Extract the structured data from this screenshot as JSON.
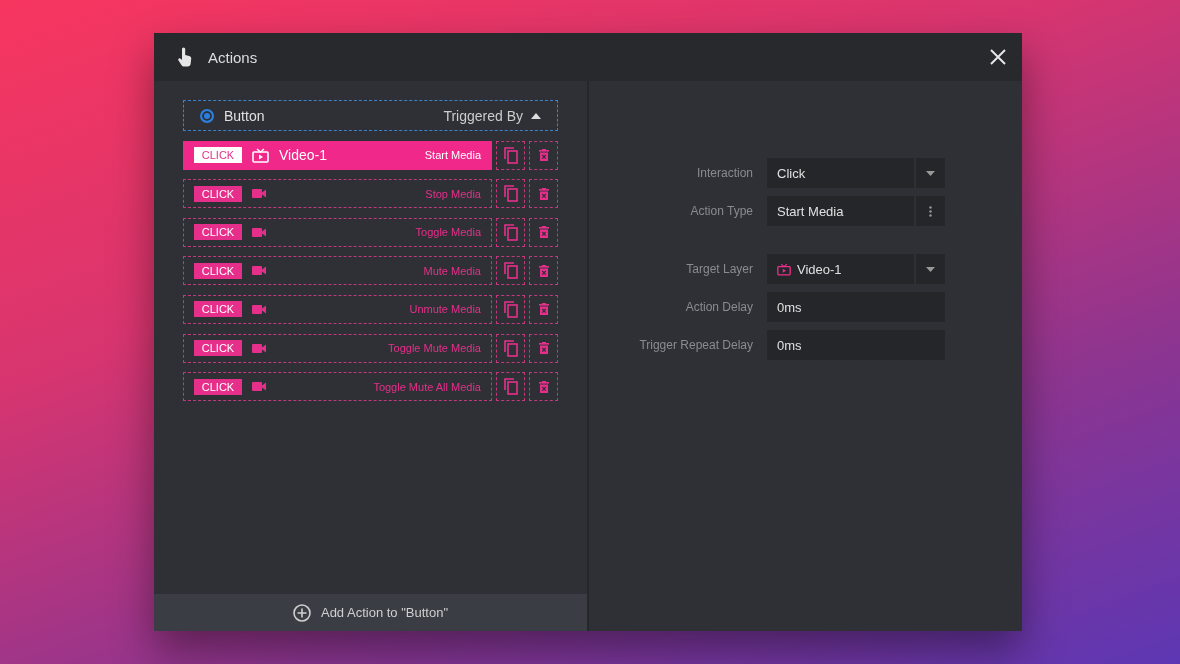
{
  "window": {
    "title": "Actions"
  },
  "trigger_header": {
    "label": "Button",
    "selected": true,
    "toggle_label": "Triggered By",
    "expanded": true
  },
  "actions": [
    {
      "trigger": "CLICK",
      "kind": "video",
      "target": "Video-1",
      "action": "Start Media",
      "selected": true
    },
    {
      "trigger": "CLICK",
      "kind": "camera",
      "action": "Stop Media",
      "selected": false
    },
    {
      "trigger": "CLICK",
      "kind": "camera",
      "action": "Toggle Media",
      "selected": false
    },
    {
      "trigger": "CLICK",
      "kind": "camera",
      "action": "Mute Media",
      "selected": false
    },
    {
      "trigger": "CLICK",
      "kind": "camera",
      "action": "Unmute Media",
      "selected": false
    },
    {
      "trigger": "CLICK",
      "kind": "camera",
      "action": "Toggle Mute Media",
      "selected": false
    },
    {
      "trigger": "CLICK",
      "kind": "camera",
      "action": "Toggle Mute All Media",
      "selected": false
    }
  ],
  "add_action": {
    "label": "Add Action to \"Button\""
  },
  "settings": [
    [
      {
        "label": "Interaction",
        "value": "Click",
        "kind": "dropdown"
      },
      {
        "label": "Action Type",
        "value": "Start Media",
        "kind": "menu"
      }
    ],
    [
      {
        "label": "Target Layer",
        "value": "Video-1",
        "kind": "layer-dropdown"
      },
      {
        "label": "Action Delay",
        "value": "0ms",
        "kind": "text"
      },
      {
        "label": "Trigger Repeat Delay",
        "value": "0ms",
        "kind": "text"
      }
    ]
  ]
}
